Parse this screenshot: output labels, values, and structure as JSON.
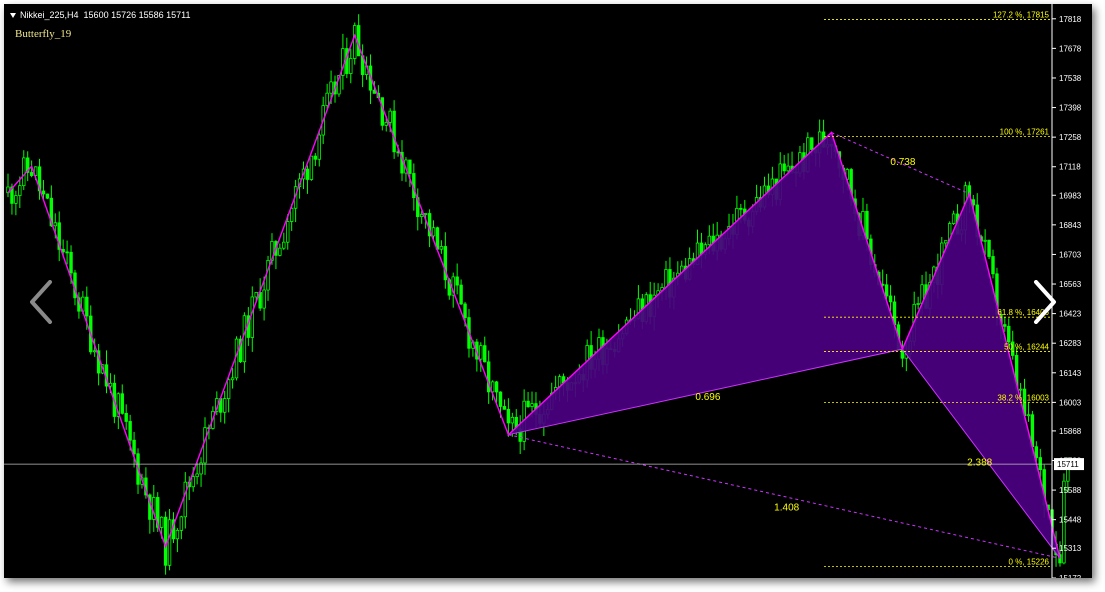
{
  "header": {
    "symbol": "Nikkei_225,H4",
    "ohlc": "15600 15726 15586 15711"
  },
  "pattern": {
    "name": "Butterfly_19"
  },
  "chart_data": {
    "type": "candlestick",
    "ylim": [
      15172,
      17888
    ],
    "y_ticks": [
      "17818",
      "17678",
      "17538",
      "17398",
      "17258",
      "17118",
      "16983",
      "16843",
      "16703",
      "16563",
      "16423",
      "16283",
      "16143",
      "16003",
      "15868",
      "15728",
      "15588",
      "15448",
      "15313",
      "15172"
    ],
    "current_price": "15711",
    "current_value": 15711,
    "zigzag": [
      {
        "bar": 0,
        "price": 16995
      },
      {
        "bar": 6,
        "price": 17120
      },
      {
        "bar": 40,
        "price": 15320
      },
      {
        "bar": 88,
        "price": 17740
      },
      {
        "bar": 127,
        "price": 15850
      },
      {
        "bar": 209,
        "price": 17280
      },
      {
        "bar": 227,
        "price": 16255
      },
      {
        "bar": 244,
        "price": 16990
      },
      {
        "bar": 267,
        "price": 15265
      }
    ],
    "ratios": [
      {
        "label": "0.738",
        "value": 0.738
      },
      {
        "label": "0.696",
        "value": 0.696
      },
      {
        "label": "1.408",
        "value": 1.408
      },
      {
        "label": "2.388",
        "value": 2.388
      }
    ],
    "fib_levels": [
      {
        "label": "127.2 %, 17815",
        "value": 17815
      },
      {
        "label": "100 %, 17261",
        "value": 17261
      },
      {
        "label": "61.8 %, 16406",
        "value": 16406
      },
      {
        "label": "50 %, 16244",
        "value": 16244
      },
      {
        "label": "38.2 %, 16003",
        "value": 16003
      },
      {
        "label": "0 %, 15226",
        "value": 15226
      }
    ],
    "colors": {
      "background": "#000000",
      "candles": "#00ff00",
      "zigzag": "#ff00ff",
      "pattern_fill": "#4b0082",
      "pattern_edge": "#cc33ff",
      "fib": "#ffff00",
      "axis_text": "#ffffff",
      "current_line": "#c0c0c0"
    }
  },
  "navigation": {
    "prev_icon": "chevron-left-icon",
    "next_icon": "chevron-right-icon"
  }
}
